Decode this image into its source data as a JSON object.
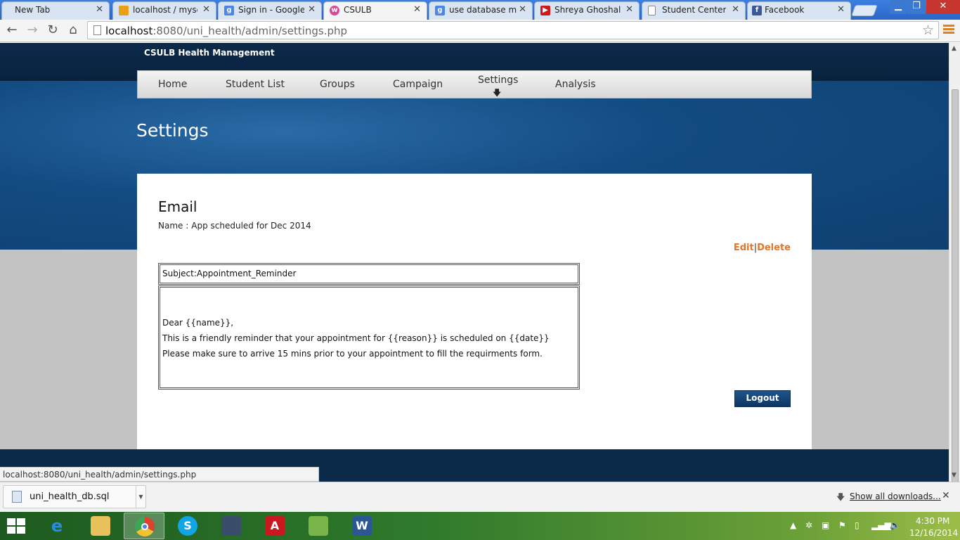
{
  "browser": {
    "tabs": [
      {
        "label": "New Tab",
        "favicon": "none",
        "color": ""
      },
      {
        "label": "localhost / mysql",
        "favicon": "phpmyadmin-icon",
        "color": "#e8a018"
      },
      {
        "label": "Sign in - Google A",
        "favicon": "google-icon",
        "color": "#4a86e8"
      },
      {
        "label": "CSULB",
        "favicon": "csulb-icon",
        "color": "#d64a9a"
      },
      {
        "label": "use database mysql",
        "favicon": "google-icon",
        "color": "#4a86e8"
      },
      {
        "label": "Shreya Ghoshal In",
        "favicon": "youtube-icon",
        "color": "#cc181e"
      },
      {
        "label": "Student Center",
        "favicon": "page-icon",
        "color": "#ffffff"
      },
      {
        "label": "Facebook",
        "favicon": "facebook-icon",
        "color": "#3b5998"
      }
    ],
    "address": {
      "host": "localhost",
      "path": ":8080/uni_health/admin/settings.php"
    },
    "status_url": "localhost:8080/uni_health/admin/settings.php"
  },
  "site": {
    "brand": "CSULB Health Management",
    "nav": [
      "Home",
      "Student List",
      "Groups",
      "Campaign",
      "Settings",
      "Analysis"
    ],
    "current_nav": "Settings",
    "page_title": "Settings"
  },
  "email": {
    "heading": "Email",
    "name_label": "Name :",
    "name_value": "App scheduled for Dec 2014",
    "edit_label": "Edit",
    "separator": "|",
    "delete_label": "Delete",
    "subject": "Subject:Appointment_Reminder",
    "body_lines": [
      "Dear {{name}},",
      "This is a friendly reminder that your appointment for {{reason}} is scheduled on {{date}}",
      "Please make sure to arrive 15 mins prior to your appointment to fill the requirments form."
    ],
    "logout_label": "Logout"
  },
  "downloads": {
    "file_name": "uni_health_db.sql",
    "show_all_label": "Show all downloads..."
  },
  "taskbar": {
    "apps": [
      {
        "name": "internet-explorer-icon",
        "glyph": "e",
        "color": "#2a8de0"
      },
      {
        "name": "file-explorer-icon",
        "glyph": "",
        "color": "#e9c15a"
      },
      {
        "name": "chrome-icon",
        "glyph": "",
        "color": "#d9432f"
      },
      {
        "name": "skype-icon",
        "glyph": "S",
        "color": "#12a5e6"
      },
      {
        "name": "network-app-icon",
        "glyph": "",
        "color": "#3a4d6a"
      },
      {
        "name": "acrobat-reader-icon",
        "glyph": "A",
        "color": "#c9191e"
      },
      {
        "name": "notepad-plus-icon",
        "glyph": "",
        "color": "#7ab54a"
      },
      {
        "name": "word-icon",
        "glyph": "W",
        "color": "#2b5797"
      }
    ],
    "time": "4:30 PM",
    "date": "12/16/2014"
  }
}
